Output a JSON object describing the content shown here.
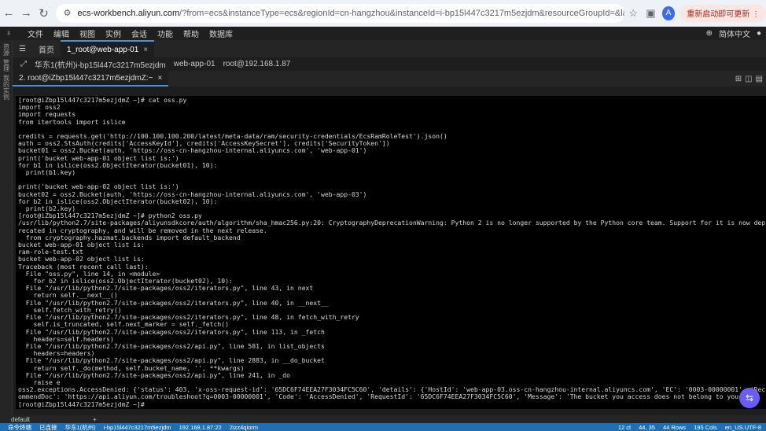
{
  "browser": {
    "url_host": "ecs-workbench.aliyun.com",
    "url_rest": "/?from=ecs&instanceType=ecs&regionId=cn-hangzhou&instanceId=i-bp15l447c3217m5ezjdm&resourceGroupId=&language=zh-CN",
    "restart_label": "重新启动即可更新 ⋮",
    "avatar_letter": "A"
  },
  "menu": {
    "items": [
      "文件",
      "编辑",
      "视图",
      "实例",
      "会话",
      "功能",
      "帮助",
      "数据库"
    ],
    "language": "简体中文"
  },
  "sidebar": {
    "rail_labels": [
      "资源",
      "管理",
      "我的实例"
    ]
  },
  "tabs": {
    "home": "首页",
    "session": "1_root@web-app-01",
    "terminal": "2. root@iZbp15l447c3217m5ezjdmZ:~"
  },
  "infobar": {
    "region": "华东1(杭州)i-bp15l447c3217m5ezjdm",
    "instance": "web-app-01",
    "login": "root@192.168.1.87"
  },
  "terminal_lines": [
    "[root@iZbp15l447c3217m5ezjdmZ ~]# cat oss.py",
    "import oss2",
    "import requests",
    "from itertools import islice",
    "",
    "credits = requests.get('http://100.100.100.200/latest/meta-data/ram/security-credentials/EcsRamRoleTest').json()",
    "auth = oss2.StsAuth(credits['AccessKeyId'], credits['AccessKeySecret'], credits['SecurityToken'])",
    "bucket01 = oss2.Bucket(auth, 'https://oss-cn-hangzhou-internal.aliyuncs.com', 'web-app-01')",
    "print('bucket web-app-01 object list is:')",
    "for b1 in islice(oss2.ObjectIterator(bucket01), 10):",
    "  print(b1.key)",
    "",
    "print('bucket web-app-02 object list is:')",
    "bucket02 = oss2.Bucket(auth, 'https://oss-cn-hangzhou-internal.aliyuncs.com', 'web-app-03')",
    "for b2 in islice(oss2.ObjectIterator(bucket02), 10):",
    "  print(b2.key)",
    "[root@iZbp15l447c3217m5ezjdmZ ~]# python2 oss.py",
    "/usr/lib/python2.7/site-packages/aliyunsdkcore/auth/algorithm/sha_hmac256.py:20: CryptographyDeprecationWarning: Python 2 is no longer supported by the Python core team. Support for it is now dep",
    "recated in cryptography, and will be removed in the next release.",
    "  from cryptography.hazmat.backends import default_backend",
    "bucket web-app-01 object list is:",
    "ram-role-test.txt",
    "bucket web-app-02 object list is:",
    "Traceback (most recent call last):",
    "  File \"oss.py\", line 14, in <module>",
    "    for b2 in islice(oss2.ObjectIterator(bucket02), 10):",
    "  File \"/usr/lib/python2.7/site-packages/oss2/iterators.py\", line 43, in next",
    "    return self.__next__()",
    "  File \"/usr/lib/python2.7/site-packages/oss2/iterators.py\", line 40, in __next__",
    "    self.fetch_with_retry()",
    "  File \"/usr/lib/python2.7/site-packages/oss2/iterators.py\", line 48, in fetch_with_retry",
    "    self.is_truncated, self.next_marker = self._fetch()",
    "  File \"/usr/lib/python2.7/site-packages/oss2/iterators.py\", line 113, in _fetch",
    "    headers=self.headers)",
    "  File \"/usr/lib/python2.7/site-packages/oss2/api.py\", line 581, in list_objects",
    "    headers=headers)",
    "  File \"/usr/lib/python2.7/site-packages/oss2/api.py\", line 2883, in __do_bucket",
    "    return self._do(method, self.bucket_name, '', **kwargs)",
    "  File \"/usr/lib/python2.7/site-packages/oss2/api.py\", line 241, in _do",
    "    raise e",
    "oss2.exceptions.AccessDenied: {'status': 403, 'x-oss-request-id': '65DC6F74EEA27F3034FC5C60', 'details': {'HostId': 'web-app-03.oss-cn-hangzhou-internal.aliyuncs.com', 'EC': '0003-00000001', 'Rec",
    "ommendDoc': 'https://api.aliyun.com/troubleshoot?q=0003-00000001', 'Code': 'AccessDenied', 'RequestId': '65DC6F74EEA27F3034FC5C60', 'Message': 'The bucket you access does not belong to you.'}}",
    "[root@iZbp15l447c3217m5ezjdmZ ~]# "
  ],
  "bottom_tab": "default",
  "statusbar": {
    "items": [
      "命令终端",
      "已连接",
      "华东1(杭州)",
      "i-bp15l447c3217m5ezjdm",
      "192.168.1.87:22",
      "2izz4qiorm"
    ],
    "right": [
      "12 ct",
      "44, 35",
      "44 Rows",
      "195 Cols",
      "en_US.UTF-8"
    ]
  },
  "colors": {
    "accent": "#4a90e2",
    "status_bg": "#1f6fb5",
    "terminal_bg": "#000000"
  }
}
